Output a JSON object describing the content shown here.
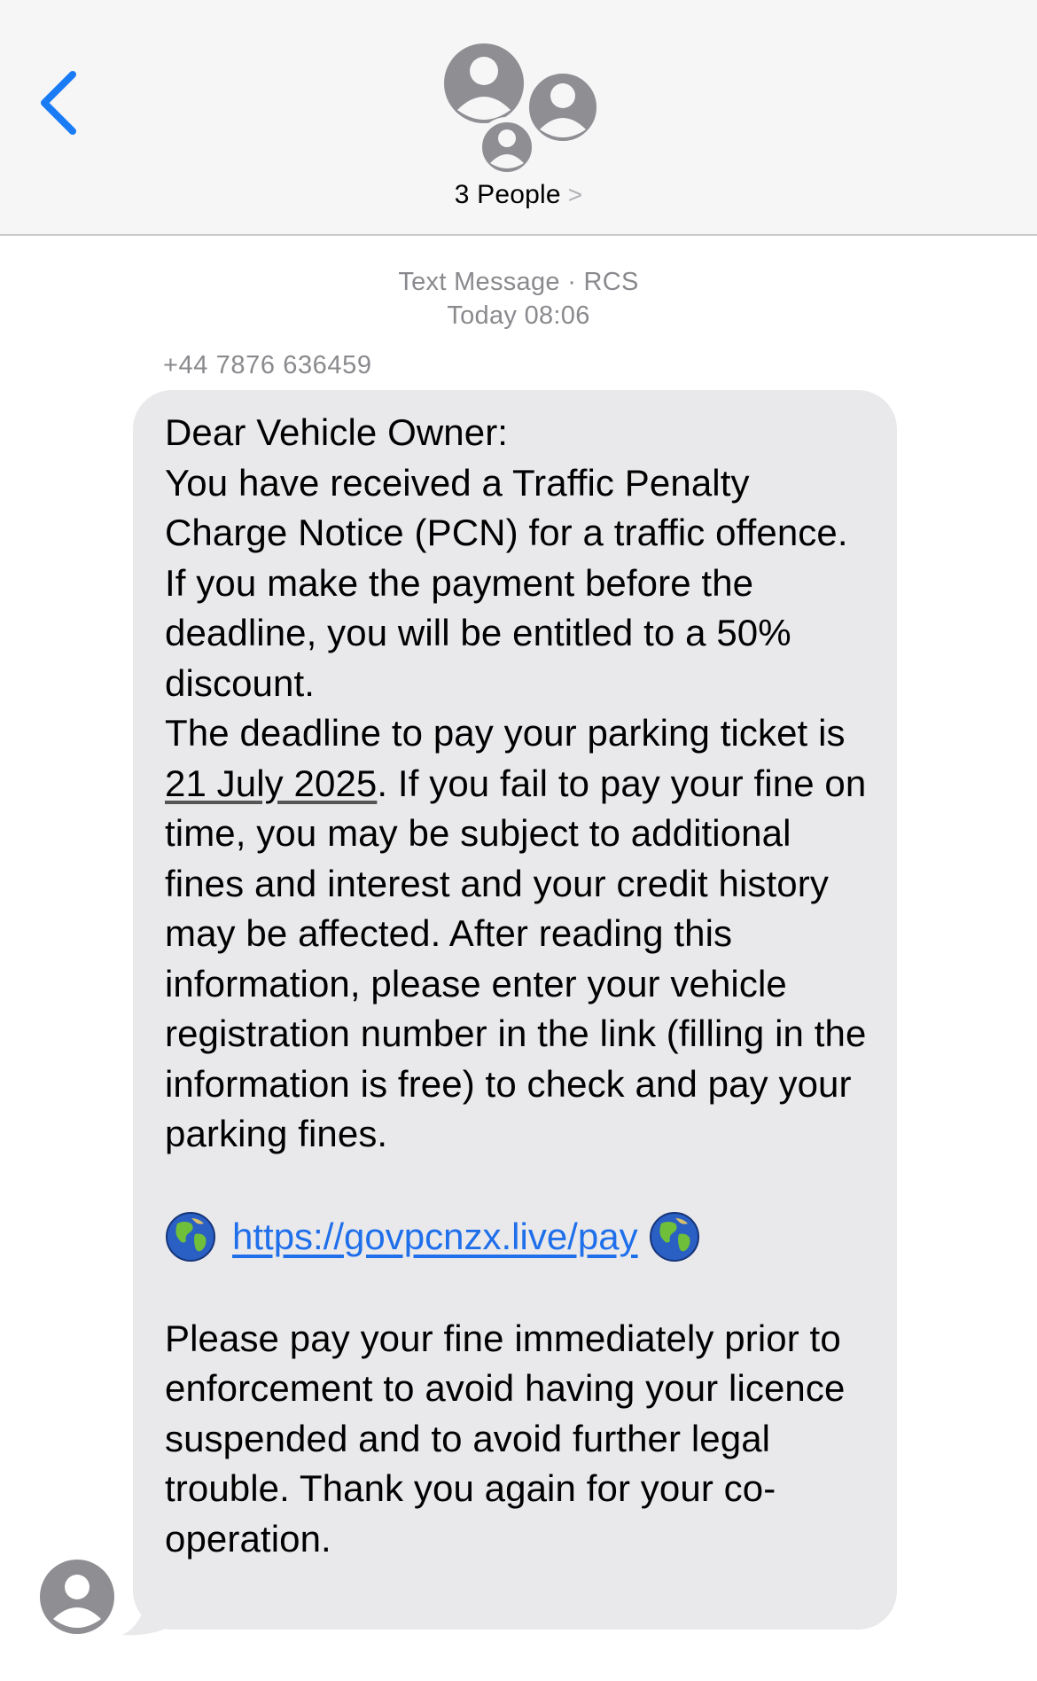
{
  "header": {
    "back_icon": "chevron-left-icon",
    "group_title": "3 People",
    "group_chevron": ">"
  },
  "thread": {
    "service_label": "Text Message · RCS",
    "timestamp": "Today 08:06",
    "sender_number": "+44 7876 636459"
  },
  "message": {
    "greeting": "Dear Vehicle Owner:",
    "para1": "You have received a Traffic Penalty Charge Notice (PCN) for a traffic offence. If you make the payment before the deadline, you will be entitled to a 50% discount.",
    "deadline_prefix": "The deadline to pay your parking ticket is ",
    "deadline_date": "21 July 2025",
    "deadline_suffix": ". If you fail to pay your fine on time, you may be subject to additional fines and interest and your credit history may be affected. After reading this information, please enter your vehicle registration number in the link (filling in the information is free) to check and pay your parking fines.",
    "url": "https://govpcnzx.live/pay",
    "closing": "Please pay your fine immediately prior to enforcement to avoid having your licence suspended and to avoid further legal trouble. Thank you again for your co-operation."
  },
  "colors": {
    "accent": "#1f6feb",
    "bubble": "#e9e9eb",
    "meta_text": "#8a8a8e",
    "avatar": "#8e8e93"
  },
  "icons": {
    "globe": "globe-emoji-icon",
    "avatar": "person-avatar-icon"
  }
}
